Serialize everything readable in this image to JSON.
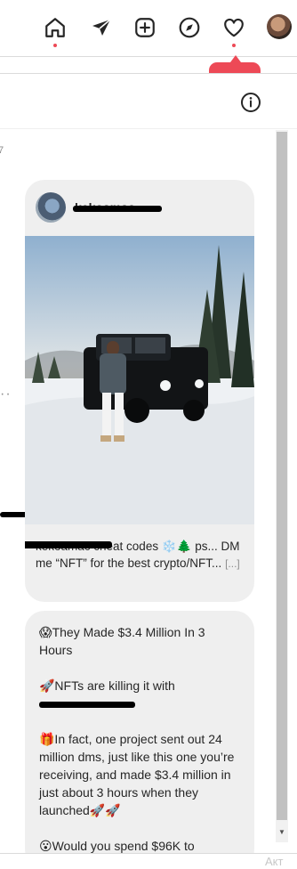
{
  "nav": {
    "icons": [
      "home-icon",
      "send-icon",
      "new-post-icon",
      "explore-icon",
      "heart-icon"
    ]
  },
  "notification": {
    "count": "2",
    "icon": "person-icon",
    "color": "#ed4956"
  },
  "panel": {
    "time_fragment": "7",
    "dots": "··"
  },
  "post": {
    "username": "kekoamac",
    "caption": "kekoamac cheat codes ❄️🌲 ps... DM me “NFT” for the best crypto/NFT...",
    "more": "[...]"
  },
  "message": {
    "line1": "😱They Made $3.4 Million In 3 Hours",
    "line2": "🚀NFTs are killing it with",
    "line3": "🎁In fact, one project sent out 24 million dms, just like this one you’re receiving, and made $3.4 million in just about 3 hours when they launched🚀🚀",
    "line4": "😮Would you spend $96K to"
  },
  "footer": {
    "corner": "Акт"
  },
  "colors": {
    "accent": "#ed4956",
    "bubble": "#efefef",
    "text": "#262626"
  }
}
